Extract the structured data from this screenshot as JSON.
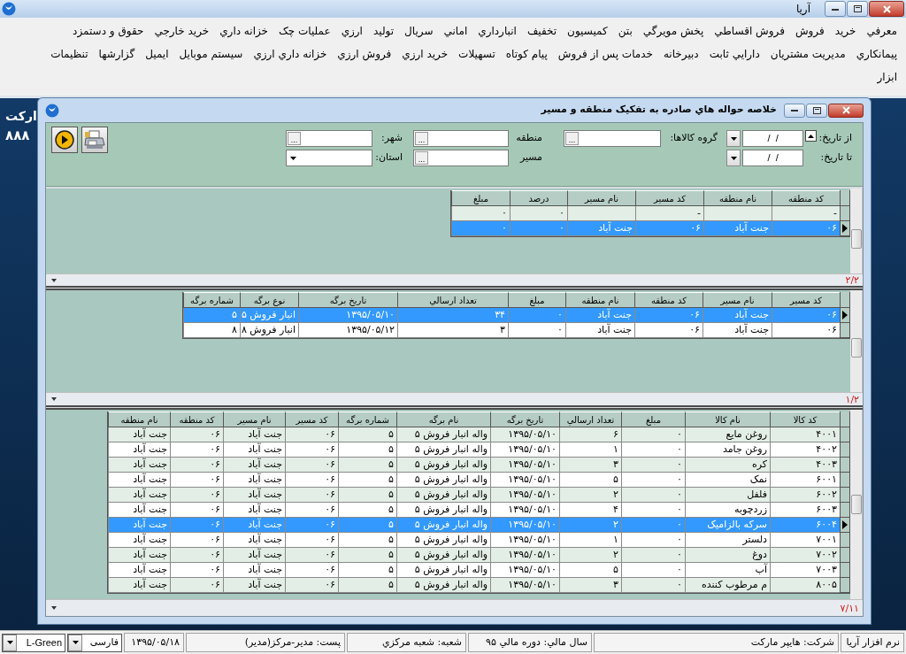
{
  "app": {
    "title": "آريا"
  },
  "menu": {
    "rows": [
      {
        "items": [
          "معرفي",
          "خريد",
          "فروش",
          "فروش اقساطي",
          "پخش مويرگي",
          "بتن",
          "كميسيون",
          "تخفيف",
          "انبارداري",
          "اماني",
          "سريال",
          "توليد",
          "ارزي",
          "عمليات چک",
          "خزانه داري",
          "خريد خارجي",
          "حقوق و دستمزد"
        ]
      },
      {
        "items": [
          "پيمانكاري",
          "مديريت مشتريان",
          "دارايي ثابت",
          "دبيرخانه",
          "خدمات پس از فروش",
          "پيام كوتاه",
          "تسهيلات",
          "خريد ارزي",
          "فروش ارزي",
          "خزانه داري ارزي",
          "سيستم موبايل",
          "ايميل",
          "گزارشها",
          "تنظيمات"
        ]
      },
      {
        "items": [
          "ابزار"
        ]
      }
    ]
  },
  "background_text": [
    "ارکت",
    "۸۸۸"
  ],
  "child_window": {
    "title": "خلاصه حواله هاي صادره به تفكيک منطقه و مسير",
    "filters": {
      "from_date": {
        "label": "از تاريخ:",
        "value": "/  /"
      },
      "to_date": {
        "label": "تا تاريخ:",
        "value": "/  /"
      },
      "goods_group": {
        "label": "گروه كالاها:",
        "button": "..."
      },
      "region": {
        "label": "منطقه",
        "button": "..."
      },
      "route": {
        "label": "مسير",
        "button": "..."
      },
      "city": {
        "label": "شهر:",
        "button": "..."
      },
      "province": {
        "label": "استان:"
      }
    },
    "grids": [
      {
        "columns": [
          "كد منطقه",
          "نام منطقه",
          "كد مسير",
          "نام مسير",
          "درصد",
          "مبلغ"
        ],
        "rows": [
          {
            "selected": false,
            "cells": [
              "-",
              null,
              "-",
              null,
              "۰",
              "۰"
            ]
          },
          {
            "selected": true,
            "cells": [
              "۰۶",
              "جنت آباد",
              "۰۶",
              "جنت آباد",
              "۰",
              "۰"
            ]
          }
        ],
        "pager": "۲/۲"
      },
      {
        "columns": [
          "كد مسير",
          "نام مسير",
          "كد منطقه",
          "نام منطقه",
          "مبلغ",
          "تعداد ارسالي",
          "تاريخ برگه",
          "نوع برگه",
          "شماره برگه"
        ],
        "rows": [
          {
            "selected": true,
            "cells": [
              "۰۶",
              "جنت آباد",
              "۰۶",
              "جنت آباد",
              "۰",
              "۳۴",
              "۱۳۹۵/۰۵/۱۰",
              "انبار فروش ۵",
              "۵"
            ]
          },
          {
            "selected": false,
            "cells": [
              "۰۶",
              "جنت آباد",
              "۰۶",
              "جنت آباد",
              "۰",
              "۳",
              "۱۳۹۵/۰۵/۱۲",
              "انبار فروش ۸",
              "۸"
            ]
          }
        ],
        "pager": "۱/۲"
      },
      {
        "columns": [
          "كد كالا",
          "نام كالا",
          "مبلغ",
          "تعداد ارسالي",
          "تاريخ برگه",
          "نام برگه",
          "شماره برگه",
          "كد مسير",
          "نام مسير",
          "كد منطقه",
          "نام منطقه"
        ],
        "rows": [
          {
            "selected": false,
            "cells": [
              "۴۰۰۱",
              "روغن مايع",
              "۰",
              "۶",
              "۱۳۹۵/۰۵/۱۰",
              "واله انبار فروش ۵",
              "۵",
              "۰۶",
              "جنت آباد",
              "۰۶",
              "جنت آباد"
            ]
          },
          {
            "selected": false,
            "cells": [
              "۴۰۰۲",
              "روغن جامد",
              "۰",
              "۱",
              "۱۳۹۵/۰۵/۱۰",
              "واله انبار فروش ۵",
              "۵",
              "۰۶",
              "جنت آباد",
              "۰۶",
              "جنت آباد"
            ]
          },
          {
            "selected": false,
            "cells": [
              "۴۰۰۳",
              "كره",
              "۰",
              "۳",
              "۱۳۹۵/۰۵/۱۰",
              "واله انبار فروش ۵",
              "۵",
              "۰۶",
              "جنت آباد",
              "۰۶",
              "جنت آباد"
            ]
          },
          {
            "selected": false,
            "cells": [
              "۶۰۰۱",
              "نمک",
              "۰",
              "۵",
              "۱۳۹۵/۰۵/۱۰",
              "واله انبار فروش ۵",
              "۵",
              "۰۶",
              "جنت آباد",
              "۰۶",
              "جنت آباد"
            ]
          },
          {
            "selected": false,
            "cells": [
              "۶۰۰۲",
              "فلفل",
              "۰",
              "۲",
              "۱۳۹۵/۰۵/۱۰",
              "واله انبار فروش ۵",
              "۵",
              "۰۶",
              "جنت آباد",
              "۰۶",
              "جنت آباد"
            ]
          },
          {
            "selected": false,
            "cells": [
              "۶۰۰۳",
              "زردچوبه",
              "۰",
              "۴",
              "۱۳۹۵/۰۵/۱۰",
              "واله انبار فروش ۵",
              "۵",
              "۰۶",
              "جنت آباد",
              "۰۶",
              "جنت آباد"
            ]
          },
          {
            "selected": true,
            "cells": [
              "۶۰۰۴",
              "سركه بالزاميک",
              "۰",
              "۲",
              "۱۳۹۵/۰۵/۱۰",
              "واله انبار فروش ۵",
              "۵",
              "۰۶",
              "جنت آباد",
              "۰۶",
              "جنت آباد"
            ]
          },
          {
            "selected": false,
            "cells": [
              "۷۰۰۱",
              "دلستر",
              "۰",
              "۱",
              "۱۳۹۵/۰۵/۱۰",
              "واله انبار فروش ۵",
              "۵",
              "۰۶",
              "جنت آباد",
              "۰۶",
              "جنت آباد"
            ]
          },
          {
            "selected": false,
            "cells": [
              "۷۰۰۲",
              "دوغ",
              "۰",
              "۲",
              "۱۳۹۵/۰۵/۱۰",
              "واله انبار فروش ۵",
              "۵",
              "۰۶",
              "جنت آباد",
              "۰۶",
              "جنت آباد"
            ]
          },
          {
            "selected": false,
            "cells": [
              "۷۰۰۳",
              "آب",
              "۰",
              "۵",
              "۱۳۹۵/۰۵/۱۰",
              "واله انبار فروش ۵",
              "۵",
              "۰۶",
              "جنت آباد",
              "۰۶",
              "جنت آباد"
            ]
          },
          {
            "selected": false,
            "cells": [
              "۸۰۰۵",
              "م مرطوب كننده",
              "۰",
              "۳",
              "۱۳۹۵/۰۵/۱۰",
              "واله انبار فروش ۵",
              "۵",
              "۰۶",
              "جنت آباد",
              "۰۶",
              "جنت آباد"
            ]
          }
        ],
        "pager": "۷/۱۱"
      }
    ]
  },
  "status_bar": {
    "items": [
      "نرم افزار آريا",
      "شركت: هايپر ماركت",
      "سال مالي: دوره مالي ۹۵",
      "شعبه: شعبه مركزي",
      "پست: مدير-مركز(مدير)",
      "۱۳۹۵/۰۵/۱۸"
    ],
    "language": "فارسی",
    "theme": "L-Green"
  }
}
